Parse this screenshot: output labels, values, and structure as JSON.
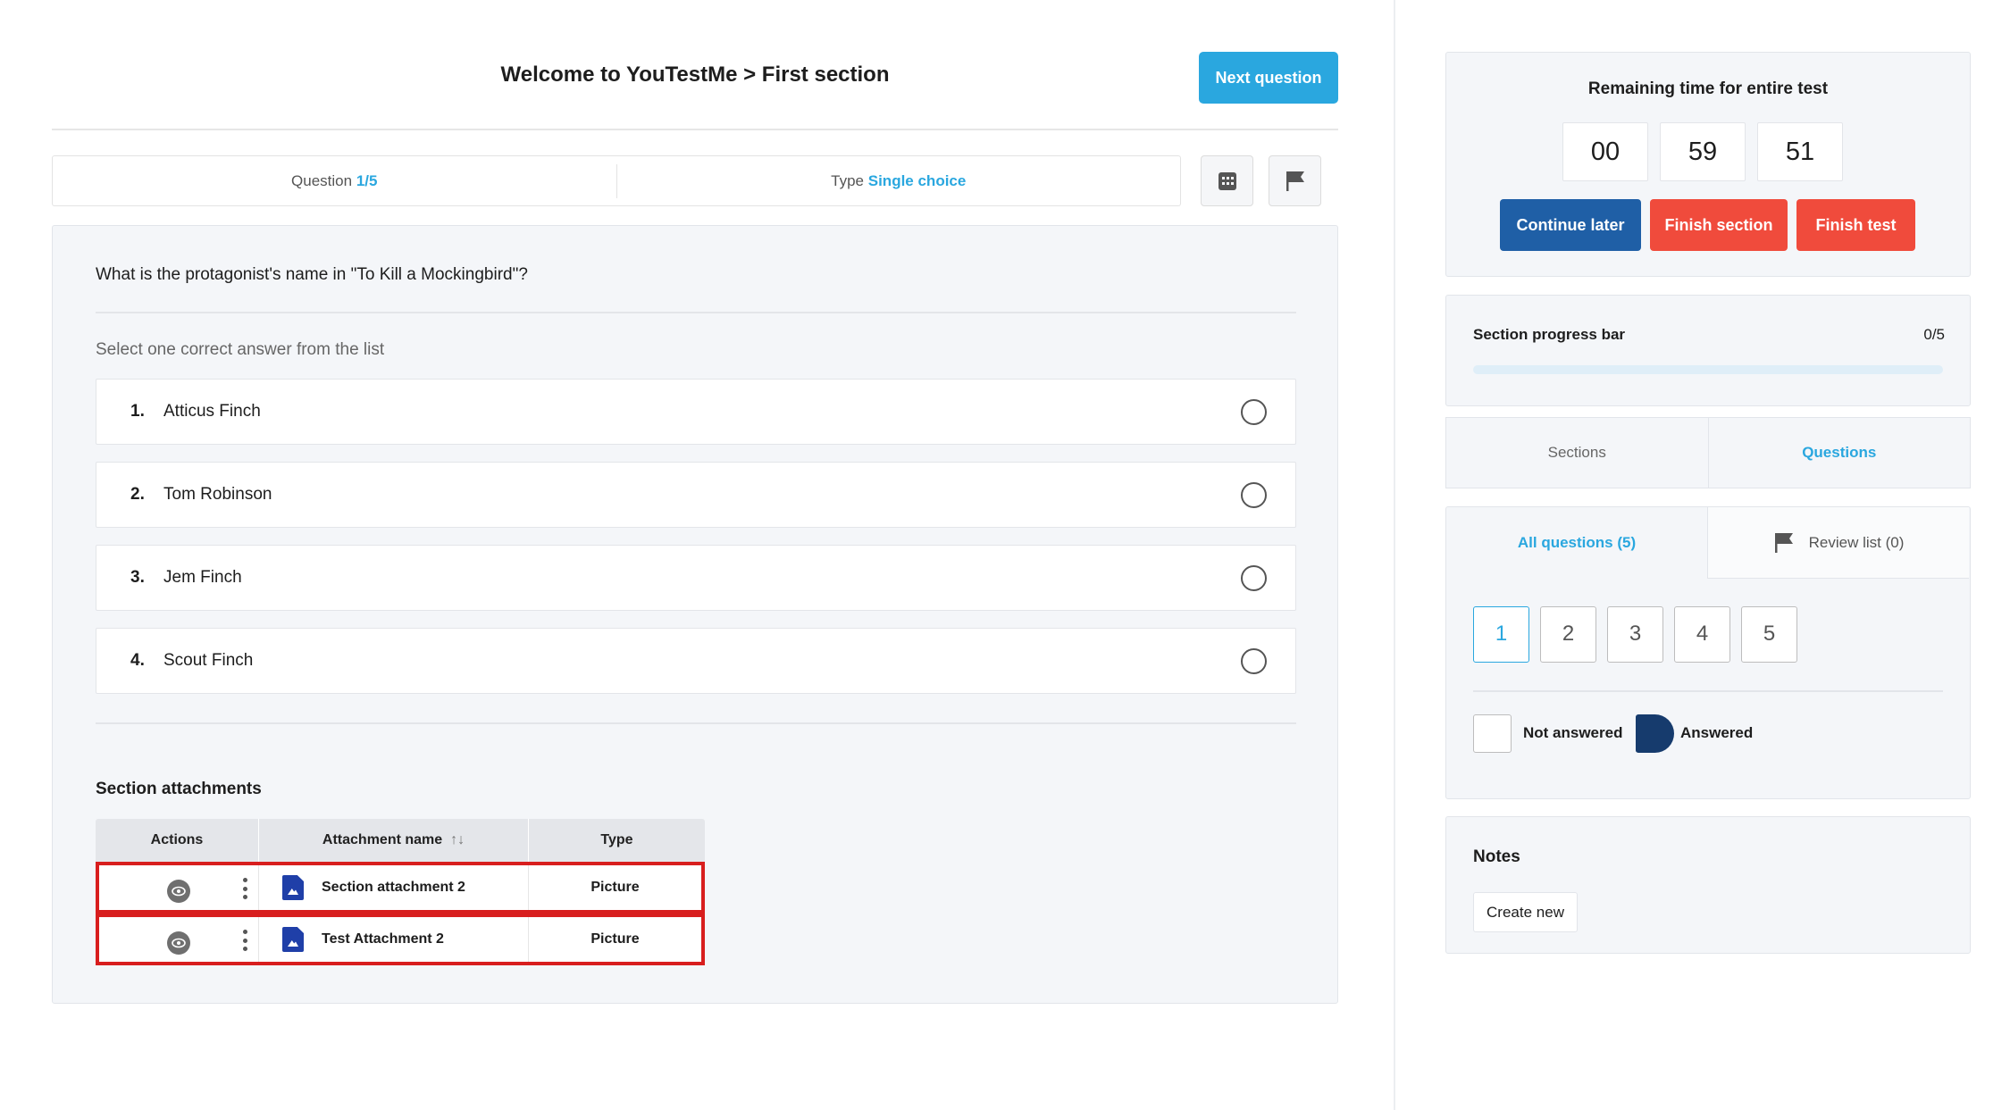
{
  "header": {
    "title": "Welcome to YouTestMe > First section",
    "next_button": "Next question"
  },
  "question_info": {
    "question_label": "Question",
    "question_value": "1/5",
    "type_label": "Type",
    "type_value": "Single choice"
  },
  "question": {
    "text": "What is the protagonist's name in \"To Kill a Mockingbird\"?",
    "instruction": "Select one correct answer from the list",
    "options": [
      {
        "num": "1.",
        "label": "Atticus Finch"
      },
      {
        "num": "2.",
        "label": "Tom Robinson"
      },
      {
        "num": "3.",
        "label": "Jem Finch"
      },
      {
        "num": "4.",
        "label": "Scout Finch"
      }
    ]
  },
  "attachments": {
    "title": "Section attachments",
    "columns": [
      "Actions",
      "Attachment name",
      "Type"
    ],
    "sort_icon": "↑↓",
    "rows": [
      {
        "name": "Section attachment 2",
        "type": "Picture"
      },
      {
        "name": "Test Attachment 2",
        "type": "Picture"
      }
    ]
  },
  "timer": {
    "title": "Remaining time for entire test",
    "hours": "00",
    "minutes": "59",
    "seconds": "51",
    "continue_label": "Continue later",
    "finish_section_label": "Finish section",
    "finish_test_label": "Finish test"
  },
  "progress": {
    "label": "Section progress bar",
    "count": "0/5",
    "fraction": 0
  },
  "tabs": {
    "sections": "Sections",
    "questions": "Questions"
  },
  "question_nav": {
    "all_label": "All questions (5)",
    "review_label": "Review list (0)",
    "numbers": [
      "1",
      "2",
      "3",
      "4",
      "5"
    ],
    "legend_not_answered": "Not answered",
    "legend_answered": "Answered"
  },
  "notes": {
    "title": "Notes",
    "create_label": "Create new"
  },
  "colors": {
    "accent": "#2aa7df",
    "primary_dark": "#1f5fa6",
    "danger": "#f04b3c",
    "answered": "#163b6d",
    "highlight_border": "#d81e1e"
  },
  "icons": [
    "calculator-icon",
    "flag-icon",
    "eye-icon",
    "kebab-menu-icon",
    "picture-file-icon",
    "sort-icon"
  ]
}
